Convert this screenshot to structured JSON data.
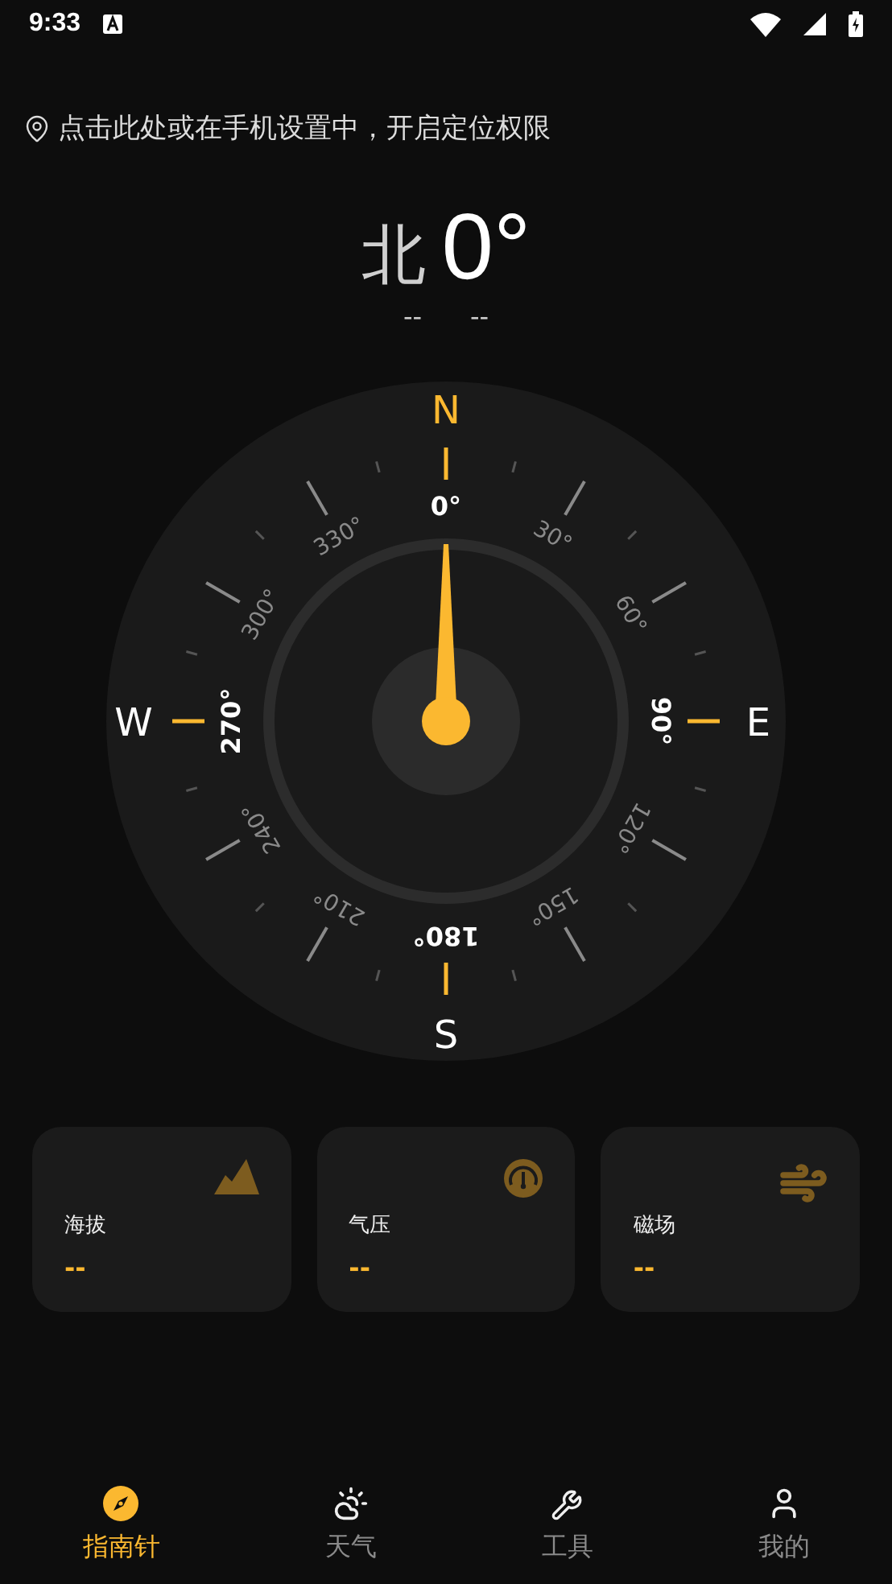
{
  "status_bar": {
    "time": "9:33"
  },
  "location_hint": "点击此处或在手机设置中，开启定位权限",
  "heading": {
    "direction": "北",
    "degrees": "0°",
    "readouts": [
      "--",
      "--"
    ]
  },
  "compass": {
    "cardinals": [
      {
        "label": "N",
        "active": true
      },
      {
        "label": "E",
        "active": false
      },
      {
        "label": "S",
        "active": false
      },
      {
        "label": "W",
        "active": false
      }
    ],
    "dial_labels": [
      {
        "label": "0°",
        "major": true
      },
      {
        "label": "30°",
        "major": false
      },
      {
        "label": "60°",
        "major": false
      },
      {
        "label": "90°",
        "major": true
      },
      {
        "label": "120°",
        "major": false
      },
      {
        "label": "150°",
        "major": false
      },
      {
        "label": "180°",
        "major": true
      },
      {
        "label": "210°",
        "major": false
      },
      {
        "label": "240°",
        "major": false
      },
      {
        "label": "270°",
        "major": true
      },
      {
        "label": "300°",
        "major": false
      },
      {
        "label": "330°",
        "major": false
      }
    ]
  },
  "cards": [
    {
      "kind": "mountain",
      "label": "海拔",
      "value": "--"
    },
    {
      "kind": "gauge",
      "label": "气压",
      "value": "--"
    },
    {
      "kind": "wind",
      "label": "磁场",
      "value": "--"
    }
  ],
  "nav": [
    {
      "kind": "compass",
      "label": "指南针",
      "selected": true
    },
    {
      "kind": "weather",
      "label": "天气",
      "selected": false
    },
    {
      "kind": "tools",
      "label": "工具",
      "selected": false
    },
    {
      "kind": "profile",
      "label": "我的",
      "selected": false
    }
  ]
}
